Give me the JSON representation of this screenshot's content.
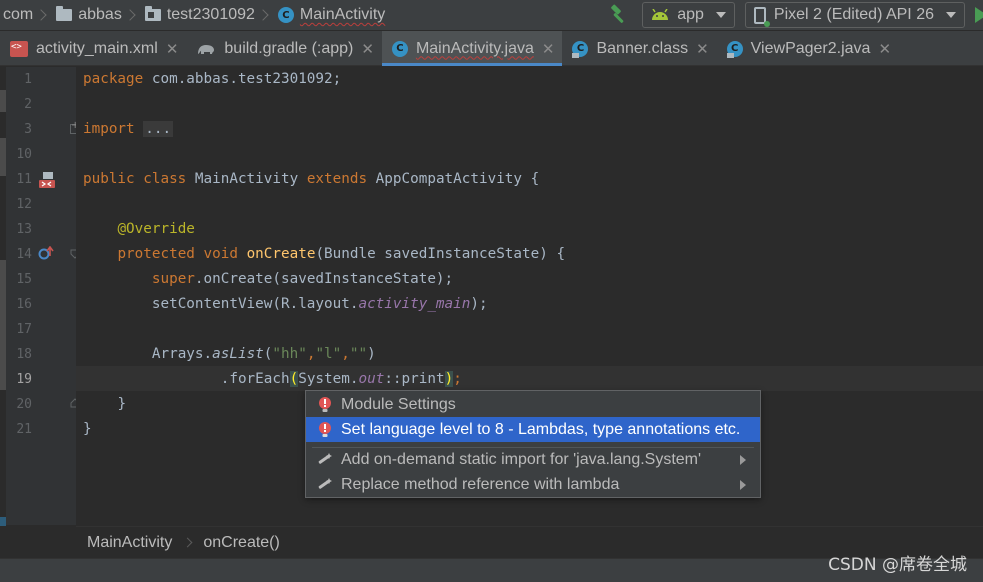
{
  "navbar": {
    "crumbs": [
      {
        "label": "com",
        "icon": "none"
      },
      {
        "label": "abbas",
        "icon": "folder-icon"
      },
      {
        "label": "test2301092",
        "icon": "folder-icon"
      },
      {
        "label": "MainActivity",
        "icon": "class-icon"
      }
    ],
    "run_config": "app",
    "device": "Pixel 2 (Edited) API 26"
  },
  "tabs": [
    {
      "label": "activity_main.xml",
      "icon": "xml-icon",
      "active": false
    },
    {
      "label": "build.gradle (:app)",
      "icon": "gradle-icon",
      "active": false
    },
    {
      "label": "MainActivity.java",
      "icon": "class-icon",
      "active": true
    },
    {
      "label": "Banner.class",
      "icon": "class-icon",
      "active": false
    },
    {
      "label": "ViewPager2.java",
      "icon": "class-icon",
      "active": false
    }
  ],
  "line_numbers": [
    "1",
    "2",
    "3",
    "10",
    "11",
    "12",
    "13",
    "14",
    "15",
    "16",
    "17",
    "18",
    "19",
    "20",
    "21"
  ],
  "current_line": "19",
  "code": {
    "l1_kw": "package",
    "l1_rest": " com.abbas.test2301092;",
    "l3_kw": "import",
    "l3_folded": "...",
    "l10": "",
    "l11_kw1": "public class",
    "l11_name": " MainActivity ",
    "l11_kw2": "extends",
    "l11_rest": " AppCompatActivity {",
    "l13_ann": "@Override",
    "l14_kw": "protected void",
    "l14_fn": "onCreate",
    "l14_rest": "(Bundle savedInstanceState) {",
    "l15_kw": "super",
    "l15_rest": ".onCreate(savedInstanceState);",
    "l16_pre": "setContentView(R.layout.",
    "l16_field": "activity_main",
    "l16_post": ");",
    "l18_pre": "Arrays.",
    "l18_method": "asList",
    "l18_open": "(",
    "l18_s1": "\"hh\"",
    "l18_c1": ",",
    "l18_s2": "\"l\"",
    "l18_c2": ",",
    "l18_s3": "\"\"",
    "l18_close": ")",
    "l19_pre": ".forEach",
    "l19_paren_open": "(",
    "l19_mid": "System.",
    "l19_field": "out",
    "l19_ref": "::print",
    "l19_paren_close": ")",
    "l19_end": ";",
    "l20": "}",
    "l21": "}"
  },
  "popup": {
    "items": [
      {
        "label": "Module Settings",
        "icon": "error-bulb-icon",
        "selected": false,
        "submenu": false
      },
      {
        "label": "Set language level to 8 - Lambdas, type annotations etc.",
        "icon": "error-bulb-icon",
        "selected": true,
        "submenu": false
      },
      {
        "label": "Add on-demand static import for 'java.lang.System'",
        "icon": "intention-icon",
        "selected": false,
        "submenu": true
      },
      {
        "label": "Replace method reference with lambda",
        "icon": "intention-icon",
        "selected": false,
        "submenu": true
      }
    ]
  },
  "code_breadcrumb": {
    "class_name": "MainActivity",
    "method_name": "onCreate()"
  },
  "watermark": "CSDN @席卷全城",
  "colors": {
    "keyword": "#cc7832",
    "annotation": "#bbb529",
    "function": "#ffc66d",
    "string": "#6a8759",
    "field": "#9876aa",
    "selection": "#2f65ca",
    "error": "#e05555"
  }
}
